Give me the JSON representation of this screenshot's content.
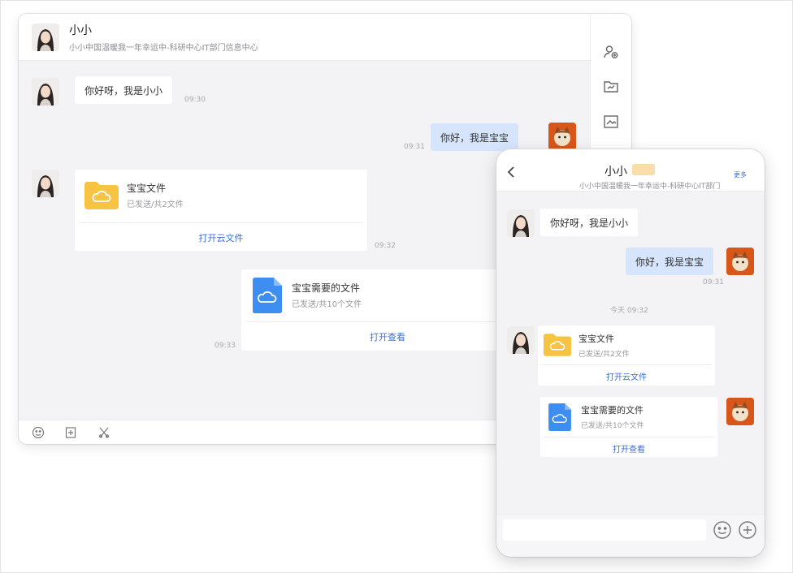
{
  "contact": {
    "name": "小小",
    "status": "小小中国温暖我一年幸运中-科研中心IT部门信息中心"
  },
  "desktop": {
    "messages": {
      "m1": {
        "text": "你好呀，我是小小",
        "time": "09:30"
      },
      "m2": {
        "text": "你好，我是宝宝",
        "time": "09:31"
      },
      "m3": {
        "file_name": "宝宝文件",
        "file_meta": "已发送/共2文件",
        "action": "打开云文件",
        "time": "09:32"
      },
      "m4": {
        "file_name": "宝宝需要的文件",
        "file_meta": "已发送/共10个文件",
        "action": "打开查看",
        "time": "09:33"
      }
    },
    "toolbar": {
      "emoji": "emoji-icon",
      "file": "file-icon",
      "cut": "scissors-icon"
    },
    "side": {
      "profile": "user-icon",
      "folder": "folder-icon",
      "image": "image-icon"
    }
  },
  "mobile": {
    "header": {
      "name": "小小",
      "sub": "小小中国温暖我一年幸运中-科研中心IT部门",
      "more": "更多"
    },
    "messages": {
      "m1": {
        "text": "你好呀，我是小小"
      },
      "m2": {
        "text": "你好，我是宝宝",
        "time": "09:31"
      },
      "divider_time": "今天 09:32",
      "m3": {
        "file_name": "宝宝文件",
        "file_meta": "已发送/共2文件",
        "action": "打开云文件"
      },
      "m4": {
        "file_name": "宝宝需要的文件",
        "file_meta": "已发送/共10个文件",
        "action": "打开查看"
      }
    },
    "input": {
      "placeholder": ""
    }
  },
  "colors": {
    "accent": "#3b6fd6",
    "out_bubble": "#d6e5fb",
    "folder": "#f6c343",
    "doc": "#3d8ef0"
  }
}
